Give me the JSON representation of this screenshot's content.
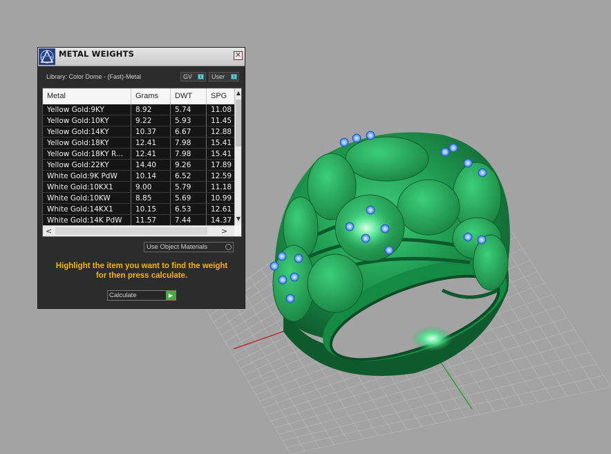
{
  "panel": {
    "title": "METAL WEIGHTS",
    "close_glyph": "✕",
    "library_label": "Library: Color Dome - (Fast)-Metal",
    "gv_label": "GV",
    "user_label": "User",
    "use_object_materials_label": "Use Object Materials",
    "instructions_line1": "Highlight the item you want to find the weight",
    "instructions_line2": "for then press calculate.",
    "calculate_label": "Calculate",
    "calculate_glyph": "▶",
    "accent_color": "#f4b400",
    "toggle_color": "#5fc9c9",
    "icons": {
      "close": "close-icon",
      "logo": "app-logo-icon",
      "go": "play-arrow-icon"
    }
  },
  "table": {
    "columns": [
      "Metal",
      "Grams",
      "DWT",
      "SPG"
    ],
    "rows": [
      [
        "Yellow Gold:9KY",
        "8.92",
        "5.74",
        "11.08"
      ],
      [
        "Yellow Gold:10KY",
        "9.22",
        "5.93",
        "11.45"
      ],
      [
        "Yellow Gold:14KY",
        "10.37",
        "6.67",
        "12.88"
      ],
      [
        "Yellow Gold:18KY",
        "12.41",
        "7.98",
        "15.41"
      ],
      [
        "Yellow Gold:18KY R...",
        "12.41",
        "7.98",
        "15.41"
      ],
      [
        "Yellow Gold:22KY",
        "14.40",
        "9.26",
        "17.89"
      ],
      [
        "White Gold:9K PdW",
        "10.14",
        "6.52",
        "12.59"
      ],
      [
        "White Gold:10KX1",
        "9.00",
        "5.79",
        "11.18"
      ],
      [
        "White Gold:10KW",
        "8.85",
        "5.69",
        "10.99"
      ],
      [
        "White Gold:14KX1",
        "10.15",
        "6.53",
        "12.61"
      ],
      [
        "White Gold:14K PdW",
        "11.57",
        "7.44",
        "14.37"
      ]
    ],
    "scroll_up_glyph": "▲",
    "scroll_down_glyph": "▼",
    "scroll_left_glyph": "<",
    "scroll_right_glyph": ">"
  },
  "viewport": {
    "background_color": "#a3a3a3",
    "model_color": "#1f8a45",
    "stone_color": "#7fb8ff"
  }
}
